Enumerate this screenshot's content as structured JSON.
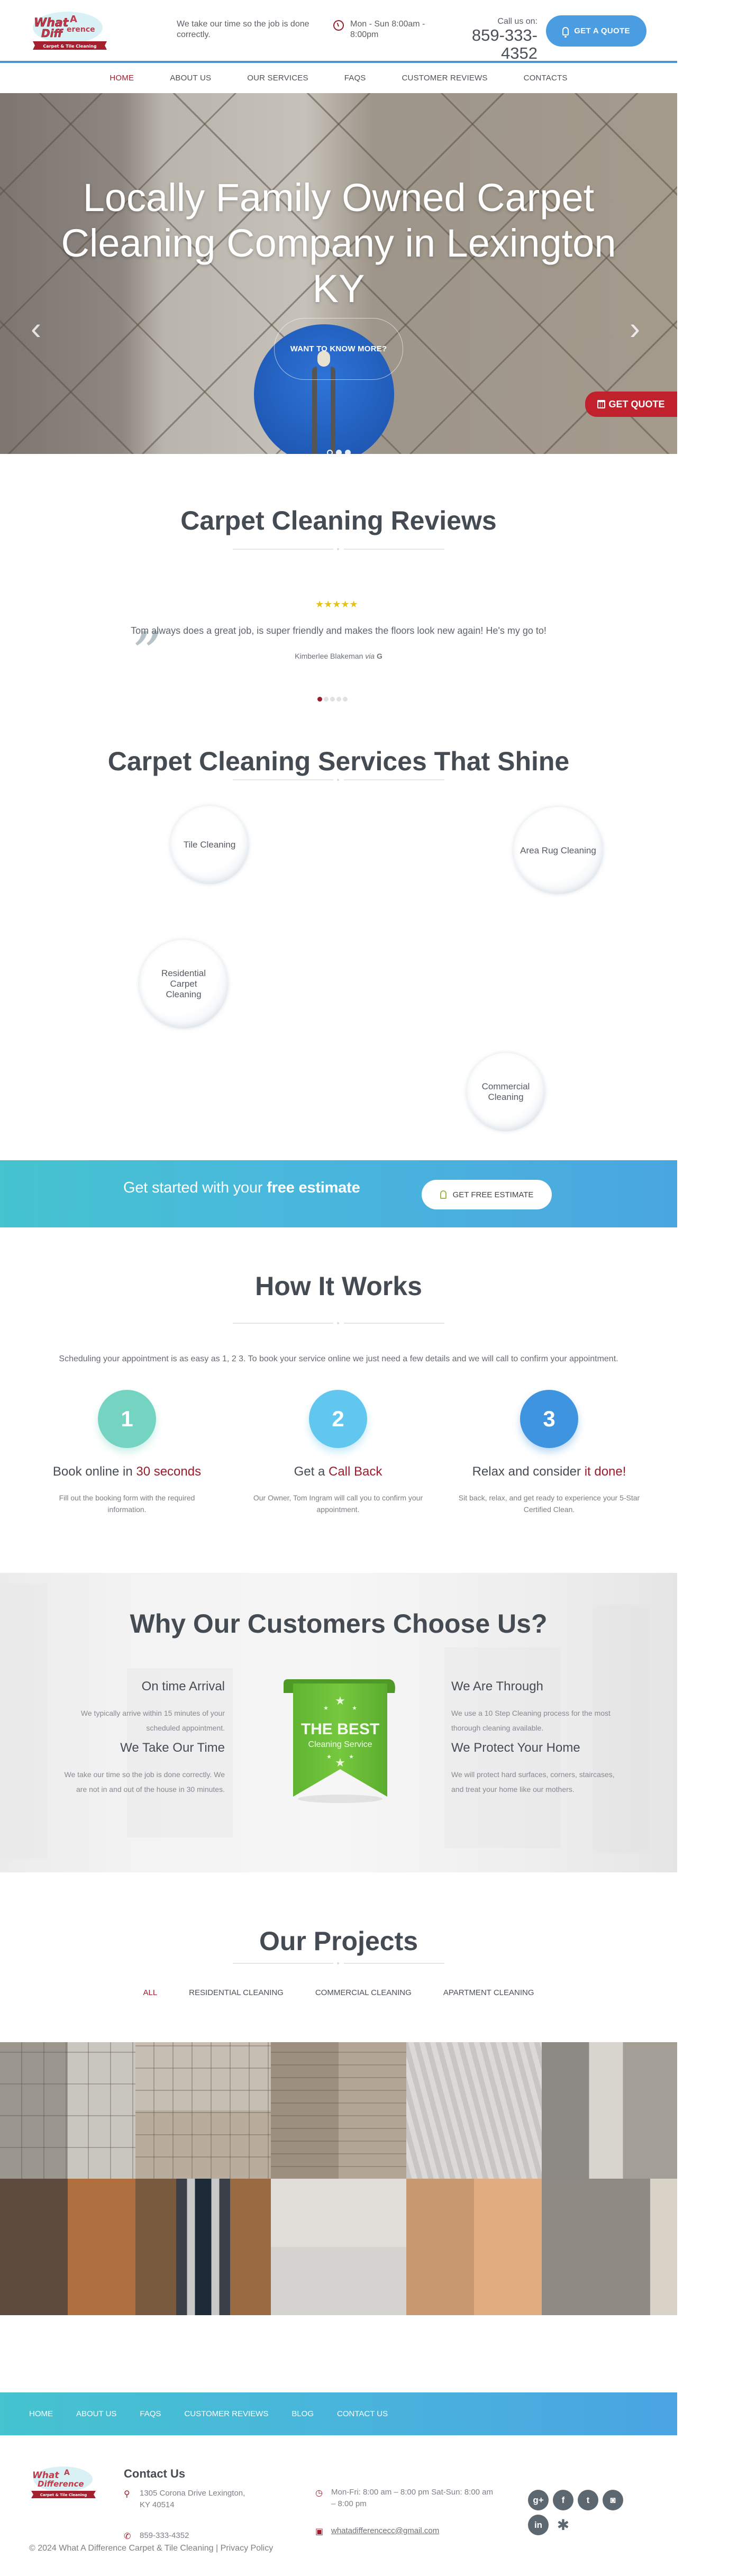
{
  "header": {
    "logo_alt": "What A Difference Carpet & Tile Cleaning",
    "logo_ribbon": "Carpet & Tile Cleaning",
    "tagline": "We take our time so the job is done correctly.",
    "hours": "Mon - Sun 8:00am - 8:00pm",
    "call_label": "Call us on:",
    "phone": "859-333-4352",
    "quote_button": "GET A QUOTE"
  },
  "nav": {
    "items": [
      {
        "label": "HOME",
        "active": true
      },
      {
        "label": "ABOUT US",
        "active": false
      },
      {
        "label": "OUR SERVICES",
        "active": false
      },
      {
        "label": "FAQS",
        "active": false
      },
      {
        "label": "CUSTOMER REVIEWS",
        "active": false
      },
      {
        "label": "CONTACTS",
        "active": false
      }
    ]
  },
  "hero": {
    "title": "Locally Family Owned Carpet Cleaning Company in Lexington KY",
    "prev": "‹",
    "next": "›",
    "button": "WANT TO KNOW MORE?",
    "slides": 3,
    "active_slide": 1,
    "side_tab": "GET QUOTE"
  },
  "reviews": {
    "title": "Carpet Cleaning Reviews",
    "rating": 5,
    "stars": "★★★★★",
    "text": "Tom always does a great job, is super friendly and makes the floors look new again! He's my go to!",
    "author": "Kimberlee Blakeman",
    "via": "via",
    "source": "G",
    "quote_mark": "”",
    "pages": 5,
    "active_page": 1
  },
  "services": {
    "title": "Carpet Cleaning Services That Shine",
    "items": [
      {
        "label": "Tile Cleaning"
      },
      {
        "label": "Area Rug Cleaning"
      },
      {
        "label": "Residential Carpet Cleaning"
      },
      {
        "label": "Commercial Cleaning"
      }
    ]
  },
  "cta": {
    "text_plain": "Get started with your ",
    "text_bold": "free estimate",
    "button": "GET FREE ESTIMATE",
    "gradient_start": "#45c3cf",
    "gradient_end": "#4aa6e0"
  },
  "how": {
    "title": "How It Works",
    "subtitle": "Scheduling your appointment is as easy as 1, 2 3. To book your service online we just need a few details and we will call to confirm your appointment.",
    "steps": [
      {
        "number": "1",
        "title_plain": "Book online in ",
        "title_highlight": "30 seconds",
        "desc": "Fill out the booking form with the required information.",
        "color": "#74d3c1"
      },
      {
        "number": "2",
        "title_plain": "Get a ",
        "title_highlight": "Call Back",
        "desc": "Our Owner, Tom Ingram will call you to confirm your appointment.",
        "color": "#62c7ef"
      },
      {
        "number": "3",
        "title_plain": "Relax and consider ",
        "title_highlight": "it done!",
        "desc": "Sit back, relax, and get ready to experience your 5-Star Certified Clean.",
        "color": "#3f94e0"
      }
    ]
  },
  "why": {
    "title": "Why Our Customers Choose Us?",
    "left": [
      {
        "title": "On time Arrival",
        "desc": "We typically arrive within 15 minutes of your scheduled appointment."
      },
      {
        "title": "We Take Our Time",
        "desc": "We take our time so the job is done correctly. We are not in and out of the house in 30 minutes."
      }
    ],
    "right": [
      {
        "title": "We Are Through",
        "desc": "We use a 10 Step Cleaning process for the most thorough cleaning available."
      },
      {
        "title": "We Protect Your Home",
        "desc": "We will protect hard surfaces, corners, staircases, and treat your home like our mothers."
      }
    ],
    "badge_line1": "THE BEST",
    "badge_line2": "Cleaning Service",
    "badge_color": "#6cbf3a"
  },
  "projects": {
    "title": "Our Projects",
    "filters": [
      {
        "label": "ALL",
        "active": true
      },
      {
        "label": "RESIDENTIAL CLEANING",
        "active": false
      },
      {
        "label": "COMMERCIAL CLEANING",
        "active": false
      },
      {
        "label": "APARTMENT CLEANING",
        "active": false
      }
    ],
    "tiles": [
      {
        "name": "tile-floor-before-after"
      },
      {
        "name": "tile-floor-hallway"
      },
      {
        "name": "carpet-stairs"
      },
      {
        "name": "carpet-room-clean"
      },
      {
        "name": "carpet-wand-cleaning"
      },
      {
        "name": "hardwood-floor-before-after"
      },
      {
        "name": "hardwood-floor-wand"
      },
      {
        "name": "upholstery-couch"
      },
      {
        "name": "wood-floor-closeup"
      },
      {
        "name": "carpet-hallway-wand"
      }
    ]
  },
  "footer": {
    "nav": [
      "HOME",
      "ABOUT US",
      "FAQS",
      "CUSTOMER REVIEWS",
      "BLOG",
      "CONTACT US"
    ],
    "contact_title": "Contact Us",
    "address": "1305 Corona Drive Lexington, KY 40514",
    "phone": "859-333-4352",
    "hours": "Mon-Fri: 8:00 am – 8:00 pm Sat-Sun: 8:00 am – 8:00 pm",
    "email": "whatadifferencecc@gmail.com",
    "socials": [
      {
        "name": "google-plus",
        "glyph": "g+"
      },
      {
        "name": "facebook",
        "glyph": "f"
      },
      {
        "name": "twitter",
        "glyph": "t"
      },
      {
        "name": "instagram",
        "glyph": "◙"
      },
      {
        "name": "linkedin",
        "glyph": "in"
      },
      {
        "name": "yelp",
        "glyph": "✱"
      }
    ],
    "copyright": "© 2024 What A Difference Carpet & Tile Cleaning | Privacy Policy"
  },
  "colors": {
    "accent_red": "#9c1c2b",
    "accent_blue": "#4a9de0",
    "quote_tab_red": "#c1202d",
    "heading": "#444b52"
  }
}
